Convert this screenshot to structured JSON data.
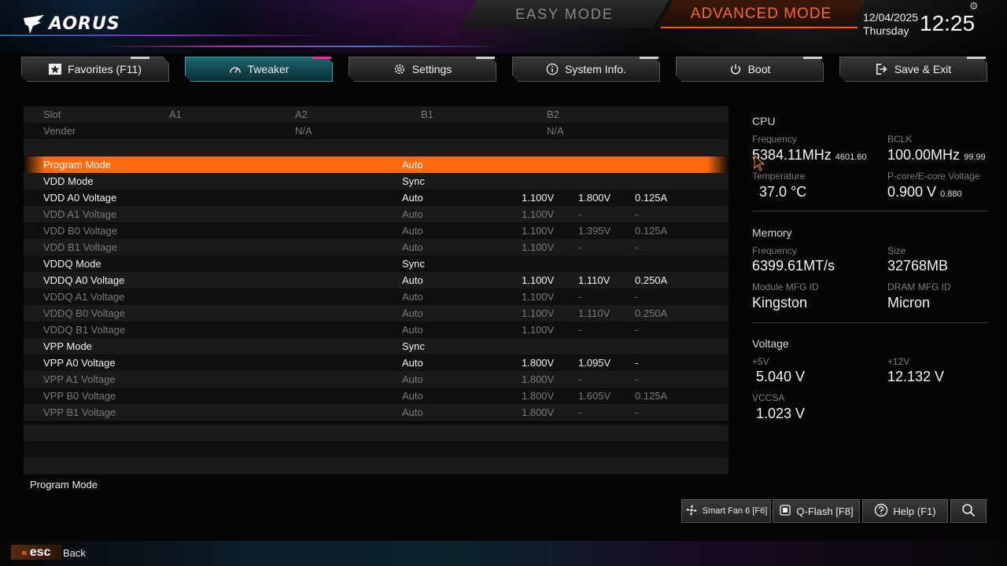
{
  "header": {
    "logo_text": "AORUS",
    "easy_mode": "EASY MODE",
    "advanced_mode": "ADVANCED MODE",
    "date": "12/04/2025",
    "day": "Thursday",
    "time": "12:25",
    "accent_color": "#ff6a10"
  },
  "nav": {
    "tabs": [
      {
        "label": "Favorites (F11)",
        "icon": "star-icon"
      },
      {
        "label": "Tweaker",
        "icon": "speedometer-icon",
        "active": true
      },
      {
        "label": "Settings",
        "icon": "gear-icon"
      },
      {
        "label": "System Info.",
        "icon": "info-icon"
      },
      {
        "label": "Boot",
        "icon": "power-icon"
      },
      {
        "label": "Save & Exit",
        "icon": "exit-icon"
      }
    ]
  },
  "table": {
    "header": {
      "slot_label": "Slot",
      "a1": "A1",
      "a2": "A2",
      "b1": "B1",
      "b2": "B2",
      "vender_label": "Vender",
      "a2_vender": "N/A",
      "b2_vender": "N/A"
    },
    "rows": [
      {
        "name": "Program Mode",
        "value": "Auto",
        "v1": "",
        "v2": "",
        "v3": "",
        "style": "hilite"
      },
      {
        "name": "VDD Mode",
        "value": "Sync",
        "v1": "",
        "v2": "",
        "v3": "",
        "style": "white"
      },
      {
        "name": "VDD A0 Voltage",
        "value": "Auto",
        "v1": "1.100V",
        "v2": "1.800V",
        "v3": "0.125A",
        "style": "white"
      },
      {
        "name": "VDD A1 Voltage",
        "value": "Auto",
        "v1": "1.100V",
        "v2": "-",
        "v3": "-",
        "style": "gray"
      },
      {
        "name": "VDD B0 Voltage",
        "value": "Auto",
        "v1": "1.100V",
        "v2": "1.395V",
        "v3": "0.125A",
        "style": "gray"
      },
      {
        "name": "VDD B1 Voltage",
        "value": "Auto",
        "v1": "1.100V",
        "v2": "-",
        "v3": "-",
        "style": "gray"
      },
      {
        "name": "VDDQ Mode",
        "value": "Sync",
        "v1": "",
        "v2": "",
        "v3": "",
        "style": "white"
      },
      {
        "name": "VDDQ A0 Voltage",
        "value": "Auto",
        "v1": "1.100V",
        "v2": "1.110V",
        "v3": "0.250A",
        "style": "white"
      },
      {
        "name": "VDDQ A1 Voltage",
        "value": "Auto",
        "v1": "1.100V",
        "v2": "-",
        "v3": "-",
        "style": "gray"
      },
      {
        "name": "VDDQ B0 Voltage",
        "value": "Auto",
        "v1": "1.100V",
        "v2": "1.110V",
        "v3": "0.250A",
        "style": "gray"
      },
      {
        "name": "VDDQ B1 Voltage",
        "value": "Auto",
        "v1": "1.100V",
        "v2": "-",
        "v3": "-",
        "style": "gray"
      },
      {
        "name": "VPP Mode",
        "value": "Sync",
        "v1": "",
        "v2": "",
        "v3": "",
        "style": "white"
      },
      {
        "name": "VPP A0 Voltage",
        "value": "Auto",
        "v1": "1.800V",
        "v2": "1.095V",
        "v3": "-",
        "style": "white"
      },
      {
        "name": "VPP A1 Voltage",
        "value": "Auto",
        "v1": "1.800V",
        "v2": "-",
        "v3": "-",
        "style": "gray"
      },
      {
        "name": "VPP B0 Voltage",
        "value": "Auto",
        "v1": "1.800V",
        "v2": "1.605V",
        "v3": "0.125A",
        "style": "gray"
      },
      {
        "name": "VPP B1 Voltage",
        "value": "Auto",
        "v1": "1.800V",
        "v2": "-",
        "v3": "-",
        "style": "gray"
      }
    ],
    "description": "Program Mode"
  },
  "info": {
    "cpu": {
      "title": "CPU",
      "freq_label": "Frequency",
      "freq": "5384.11MHz",
      "freq_sub": "4601.60",
      "bclk_label": "BCLK",
      "bclk": "100.00MHz",
      "bclk_sub": "99.99",
      "temp_label": "Temperature",
      "temp": "37.0 °C",
      "volt_label": "P-core/E-core Voltage",
      "volt": "0.900 V",
      "volt_sub": "0.880"
    },
    "memory": {
      "title": "Memory",
      "freq_label": "Frequency",
      "freq": "6399.61MT/s",
      "size_label": "Size",
      "size": "32768MB",
      "mfg_label": "Module MFG ID",
      "mfg": "Kingston",
      "dram_label": "DRAM MFG ID",
      "dram": "Micron"
    },
    "voltage": {
      "title": "Voltage",
      "v5_label": "+5V",
      "v5": "5.040 V",
      "v12_label": "+12V",
      "v12": "12.132 V",
      "vccsa_label": "VCCSA",
      "vccsa": "1.023 V"
    }
  },
  "bottom": {
    "smart_fan": "Smart Fan 6 [F6]",
    "qflash": "Q-Flash [F8]",
    "help": "Help (F1)",
    "esc": "esc",
    "back": "Back"
  }
}
